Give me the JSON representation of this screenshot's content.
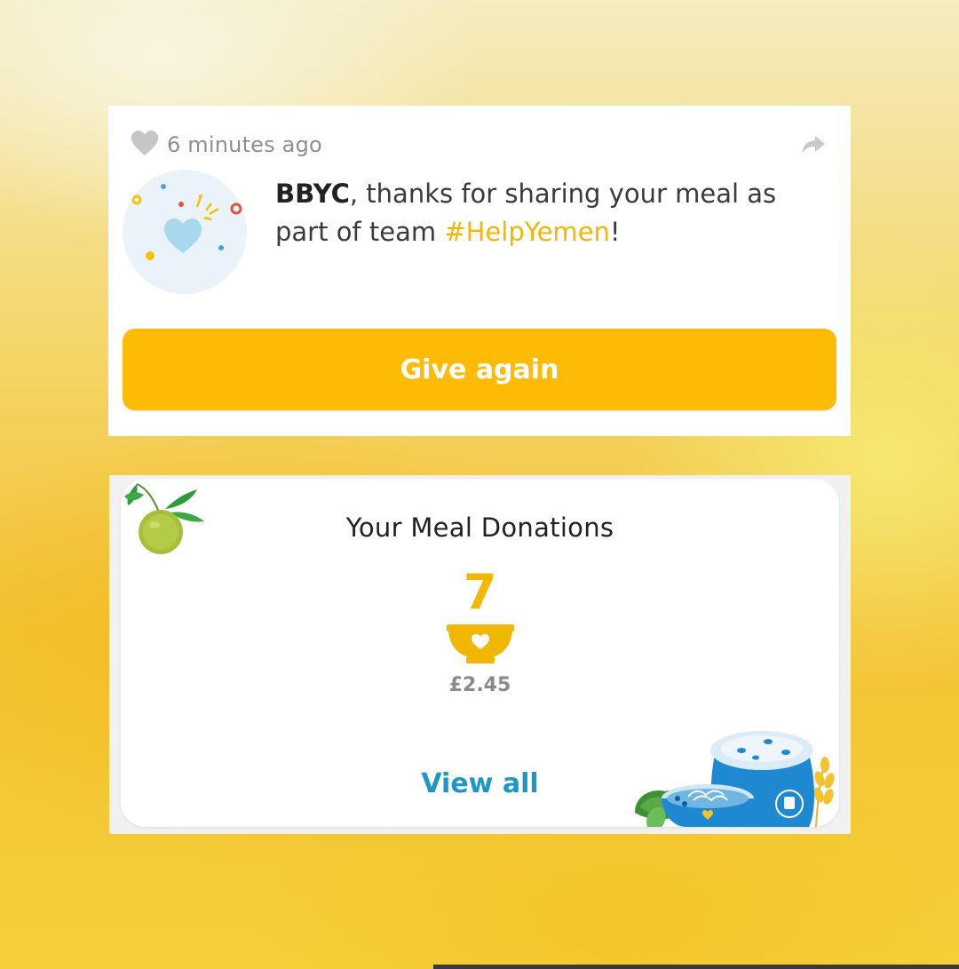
{
  "post": {
    "time_ago": "6 minutes ago",
    "user_name": "BBYC",
    "message_mid": ", thanks for sharing your meal as part of team ",
    "team_tag": "#HelpYemen",
    "message_end": "!",
    "give_again_label": "Give again",
    "icons": {
      "like": "heart-icon",
      "share": "share-arrow-icon",
      "avatar": "celebration-heart-avatar"
    }
  },
  "donations": {
    "title": "Your Meal Donations",
    "count": "7",
    "amount": "£2.45",
    "view_all_label": "View all",
    "icons": {
      "bowl": "heart-bowl-icon",
      "corner_top": "lime-illustration",
      "corner_bottom": "wfp-food-illustration"
    }
  },
  "colors": {
    "accent_yellow": "#fdbb05",
    "tag_yellow": "#f2b705",
    "link_blue": "#1b98c8",
    "muted_gray": "#8e8e8e",
    "wfp_blue": "#1e88d0"
  }
}
